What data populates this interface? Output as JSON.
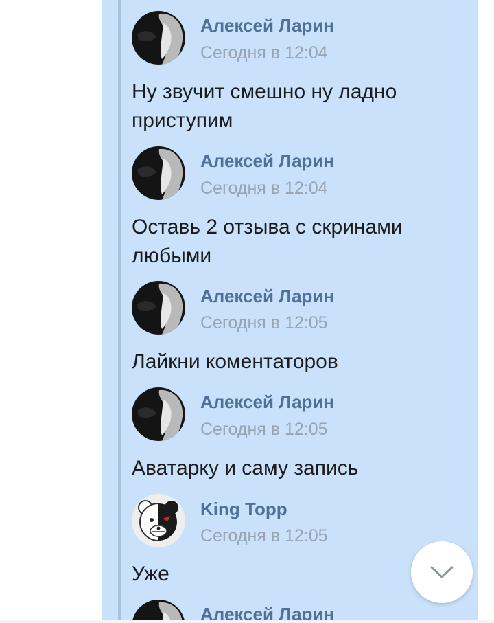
{
  "messages": [
    {
      "author": "Алексей Ларин",
      "time": "Сегодня в 12:04",
      "text": "Ну звучит смешно ну ладно приступим",
      "avatar": "dark-portrait"
    },
    {
      "author": "Алексей Ларин",
      "time": "Сегодня в 12:04",
      "text": "Оставь 2 отзыва с скринами любыми",
      "avatar": "dark-portrait"
    },
    {
      "author": "Алексей Ларин",
      "time": "Сегодня в 12:05",
      "text": "Лайкни коментаторов",
      "avatar": "dark-portrait"
    },
    {
      "author": "Алексей Ларин",
      "time": "Сегодня в 12:05",
      "text": "Аватарку и саму запись",
      "avatar": "dark-portrait"
    },
    {
      "author": "King Topp",
      "time": "Сегодня в 12:05",
      "text": "Уже",
      "avatar": "monokuma-bear"
    },
    {
      "author": "Алексей Ларин",
      "time": "",
      "text": "",
      "avatar": "dark-portrait"
    }
  ],
  "scroll_button": {
    "icon": "chevron-down-icon"
  },
  "colors": {
    "thread_bg": "#c9e1fa",
    "author": "#4f7099",
    "time": "#97a4b2",
    "text": "#1b1b1b"
  }
}
